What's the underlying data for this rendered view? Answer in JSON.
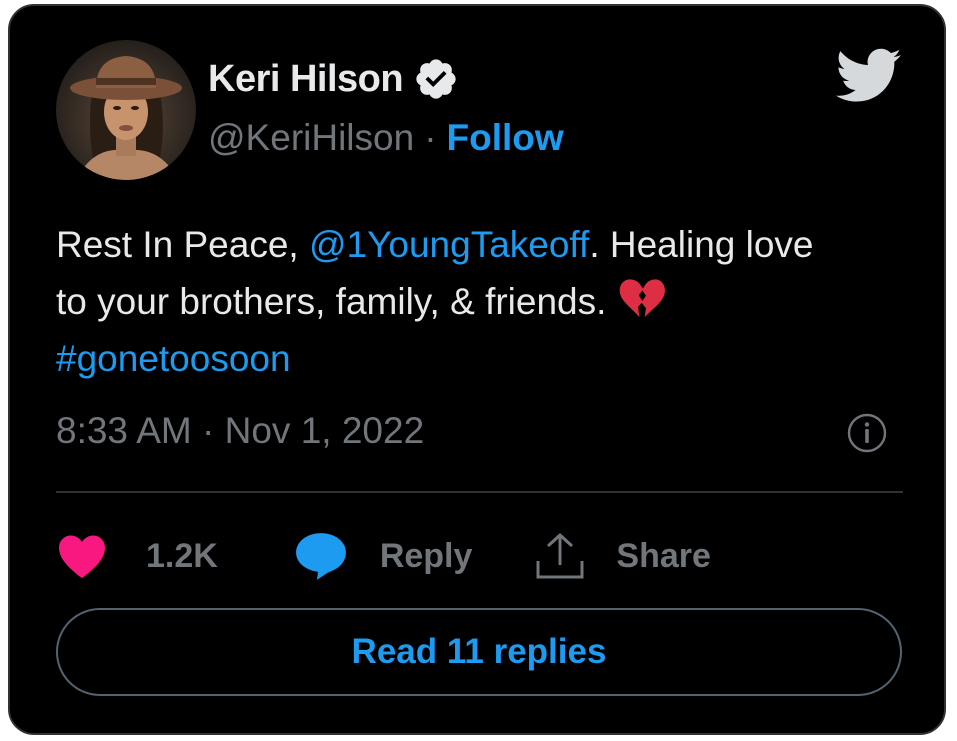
{
  "author": {
    "name": "Keri Hilson",
    "handle": "@KeriHilson",
    "separator": "·",
    "follow_label": "Follow"
  },
  "tweet": {
    "text_prefix": "Rest In Peace, ",
    "mention": "@1YoungTakeoff",
    "text_line1_suffix": ". Healing love",
    "text_line2": "to your brothers, family, & friends. ",
    "hashtag": "#gonetoosoon",
    "emoji": "broken-heart-emoji",
    "timestamp": "8:33 AM · Nov 1, 2022"
  },
  "actions": {
    "like_count": "1.2K",
    "reply_label": "Reply",
    "share_label": "Share"
  },
  "read_replies_label": "Read 11 replies",
  "icons": {
    "verified": "verified-badge-icon",
    "twitter": "twitter-bird-icon",
    "info": "info-icon",
    "like": "heart-icon",
    "reply": "speech-bubble-icon",
    "share": "share-upload-icon"
  },
  "colors": {
    "background": "#000000",
    "text": "#e7e9ea",
    "muted": "#71767b",
    "link": "#1d9bf0",
    "like": "#f91880",
    "border": "#2f3336",
    "emoji": "#dd2e44"
  }
}
